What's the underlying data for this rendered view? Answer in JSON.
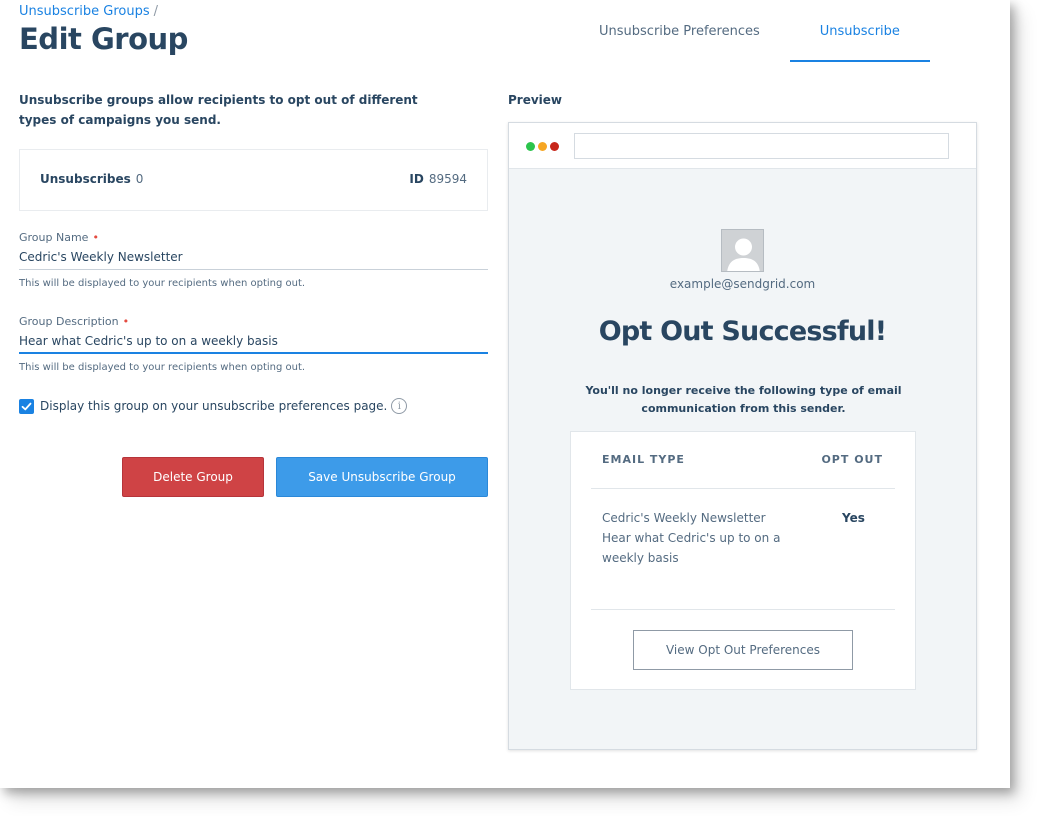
{
  "header": {
    "breadcrumb": "Unsubscribe Groups",
    "breadcrumb_separator": "/",
    "title": "Edit Group"
  },
  "tabs": [
    {
      "label": "Unsubscribe Preferences",
      "active": false
    },
    {
      "label": "Unsubscribe",
      "active": true
    }
  ],
  "form": {
    "intro": "Unsubscribe groups allow recipients to opt out of different types of campaigns you send.",
    "stats": {
      "unsubscribes_label": "Unsubscribes",
      "unsubscribes_value": "0",
      "id_label": "ID",
      "id_value": "89594"
    },
    "group_name": {
      "label": "Group Name",
      "required_mark": "•",
      "value": "Cedric's Weekly Newsletter",
      "help": "This will be displayed to your recipients when opting out."
    },
    "group_description": {
      "label": "Group Description",
      "required_mark": "•",
      "value": "Hear what Cedric's up to on a weekly basis",
      "help": "This will be displayed to your recipients when opting out."
    },
    "display_checkbox": {
      "label": "Display this group on your unsubscribe preferences page.",
      "checked": true,
      "info_glyph": "i"
    },
    "delete_label": "Delete Group",
    "save_label": "Save Unsubscribe Group"
  },
  "preview": {
    "label": "Preview",
    "email": "example@sendgrid.com",
    "title": "Opt Out Successful!",
    "description": "You'll no longer receive the following type of email communication from this sender.",
    "table": {
      "col_email_type": "EMAIL TYPE",
      "col_opt_out": "OPT OUT",
      "rows": [
        {
          "name": "Cedric's Weekly Newsletter",
          "description": "Hear what Cedric's up to on a weekly basis",
          "opt_out": "Yes"
        }
      ]
    },
    "view_prefs_label": "View Opt Out Preferences"
  },
  "colors": {
    "accent": "#1a82e2",
    "danger": "#cf4345",
    "primary_button": "#3d9be9",
    "text_dark": "#294661"
  },
  "icons": [
    "checkbox-check-icon",
    "info-icon",
    "window-dot-green",
    "window-dot-orange",
    "window-dot-red",
    "avatar-placeholder-icon"
  ]
}
